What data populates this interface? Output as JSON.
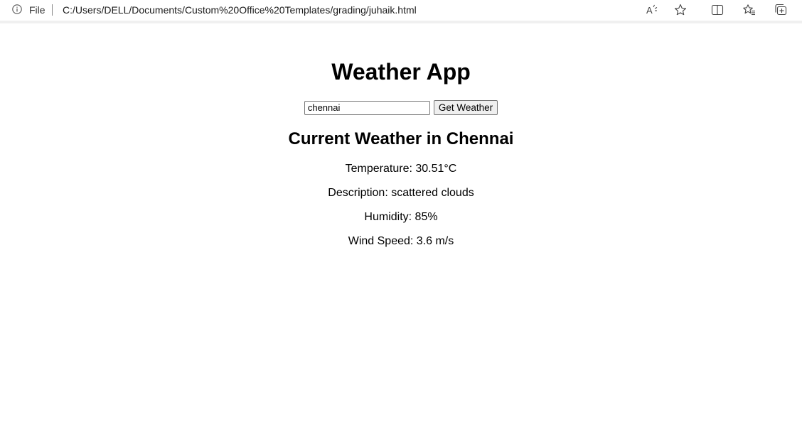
{
  "browser": {
    "file_label": "File",
    "url": "C:/Users/DELL/Documents/Custom%20Office%20Templates/grading/juhaik.html",
    "icons": [
      "info-icon",
      "read-aloud-icon",
      "favorite-star-icon",
      "split-screen-icon",
      "favorites-icon",
      "collections-icon"
    ]
  },
  "app": {
    "title": "Weather App",
    "search": {
      "value": "chennai",
      "button_label": "Get Weather"
    },
    "current_heading": "Current Weather in Chennai",
    "details": {
      "temperature": "Temperature: 30.51°C",
      "description": "Description: scattered clouds",
      "humidity": "Humidity: 85%",
      "wind_speed": "Wind Speed: 3.6 m/s"
    }
  }
}
